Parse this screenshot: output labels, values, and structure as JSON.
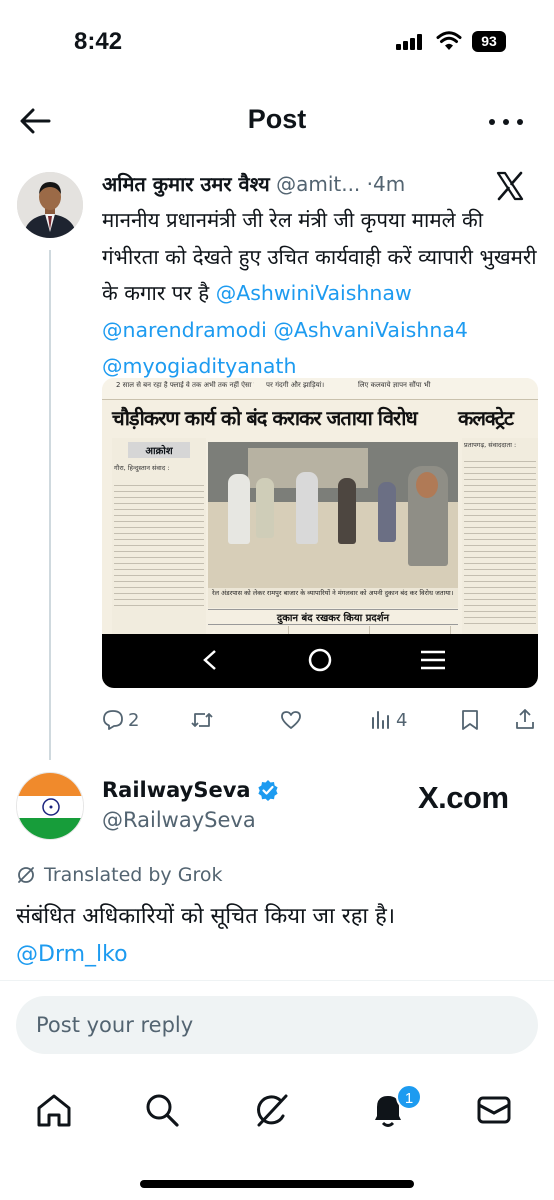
{
  "status_bar": {
    "time": "8:42",
    "battery": "93"
  },
  "header": {
    "title": "Post"
  },
  "quoted_post": {
    "author_name": "अमित कुमार उमर वैश्य",
    "handle": "@amit...",
    "separator": "·",
    "time": "4m",
    "text_before_mentions": "माननीय प्रधानमंत्री जी रेल मंत्री जी कृपया मामले की गंभीरता को देखते हुए उचित कार्यवाही करें व्यापारी भुखमरी के कगार पर है ",
    "mentions": [
      "@AshwiniVaishnaw",
      "@narendramodi",
      "@AshvaniVaishna4",
      "@myogiadityanath"
    ],
    "image": {
      "headline": "चौड़ीकरण कार्य को बंद कराकर जताया विरोध",
      "side_headline": "कलक्ट्रेट",
      "section_label": "आक्रोश",
      "subheading": "दुकान बंद रखकर किया प्रदर्शन",
      "top_snippet_1": "2 साल से बन रहा है फ्लाई वे तक अभी तक नहीं ऐसा हाल",
      "top_snippet_2": "पर गंदगी और झाड़ियां।",
      "top_snippet_3": "लिए कलवाये ज्ञापन सौंपा भी",
      "caption": "रेल अंडरपास को लेकर रामपुर बाजार के व्यापारियों ने मंगलवार को अपनी दुकान बंद कर विरोध जताया।",
      "dateline": "गौरा, हिन्दुस्तान संवाद :",
      "right_dateline": "प्रतापगढ़, संवाददाता :"
    },
    "stats": {
      "replies": "2",
      "retweets": "",
      "likes": "",
      "views": "4"
    }
  },
  "reply": {
    "name": "RailwaySeva",
    "handle": "@RailwaySeva",
    "source": "X.com",
    "translated_label": "Translated by Grok",
    "text": "संबंधित अधिकारियों को सूचित किया जा रहा है।",
    "mention": "@Drm_lko"
  },
  "reply_input": {
    "placeholder": "Post your reply"
  },
  "bottom_nav": {
    "notification_count": "1"
  },
  "colors": {
    "accent": "#1d9bf0",
    "muted": "#536471",
    "verified": "#1d9bf0"
  }
}
